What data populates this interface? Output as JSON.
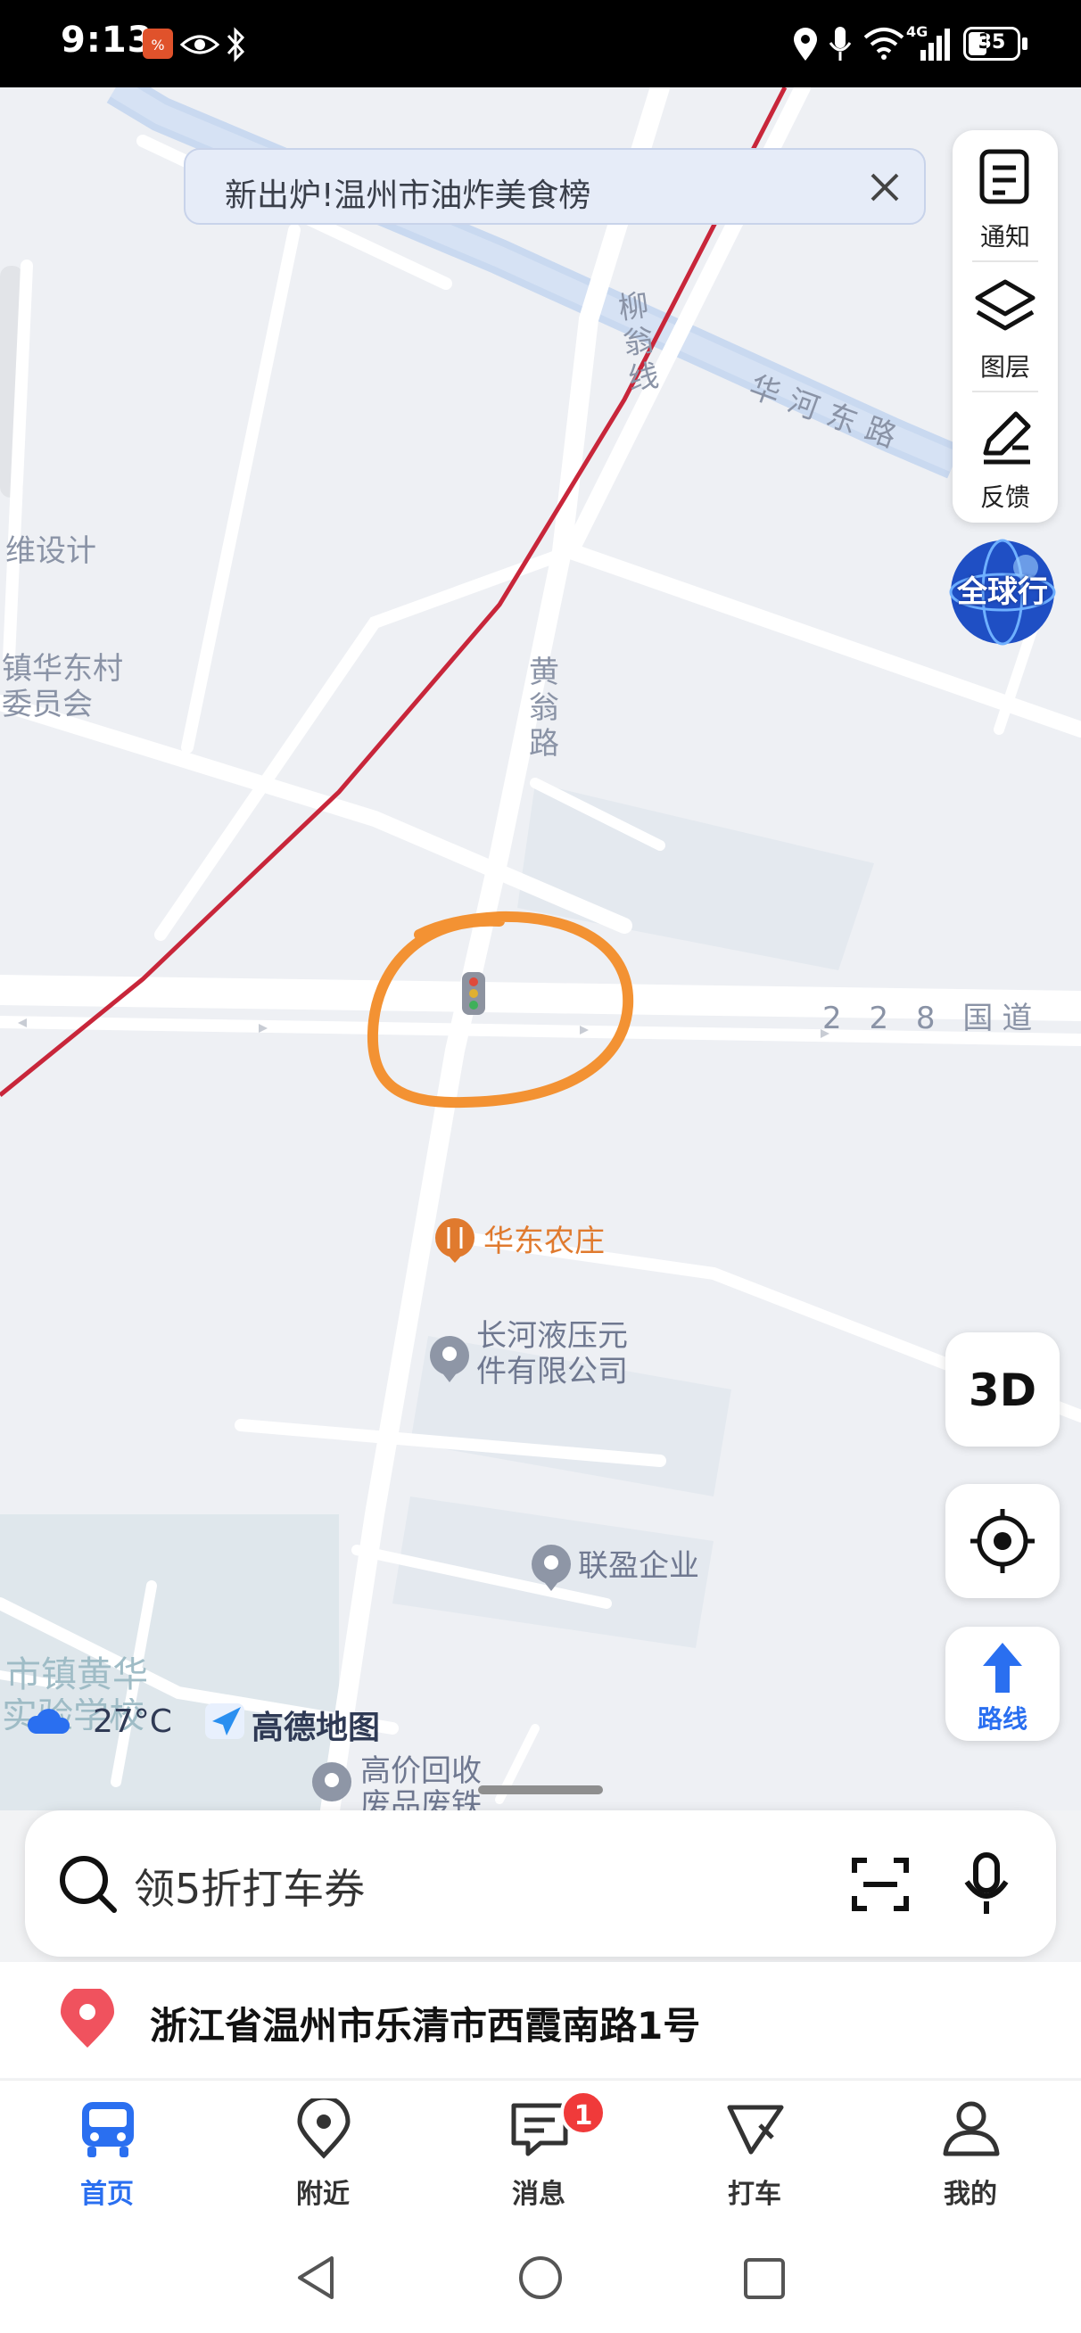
{
  "status_bar": {
    "time": "9:13",
    "battery": "35",
    "network": "4G"
  },
  "notice": {
    "text": "新出炉!温州市油炸美食榜"
  },
  "tools": {
    "notify": "通知",
    "layers": "图层",
    "feedback": "反馈"
  },
  "globe_label": "全球行",
  "map": {
    "labels": {
      "liuweng_road": "柳翁线",
      "huahe_road": "华河东路",
      "huangweng_road": "黄翁路",
      "national_road": "2 2 8 国道",
      "design": "维设计",
      "village_line1": "镇华东村",
      "village_line2": "委员会",
      "town_line1": "市镇黄华",
      "town_line2": "实验学校"
    },
    "pois": {
      "restaurant": "华东农庄",
      "company_line1": "长河液压元",
      "company_line2": "件有限公司",
      "enterprise": "联盈企业",
      "recycle_line1": "高价回收",
      "recycle_line2": "废品废铁"
    }
  },
  "controls": {
    "three_d": "3D",
    "route": "路线"
  },
  "weather": "27°C",
  "brand": "高德地图",
  "search": {
    "placeholder": "领5折打车券"
  },
  "current_location": "浙江省温州市乐清市西霞南路1号",
  "bottom_nav": {
    "home": "首页",
    "nearby": "附近",
    "messages": "消息",
    "messages_badge": "1",
    "taxi": "打车",
    "mine": "我的"
  },
  "colors": {
    "accent": "#2a6ff0",
    "railway": "#c8263a",
    "highlight_circle": "#f39233",
    "poi_restaurant": "#e07a2e"
  }
}
